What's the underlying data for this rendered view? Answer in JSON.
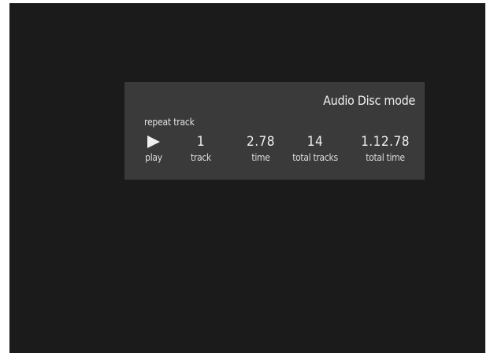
{
  "player": {
    "mode_title": "Audio Disc mode",
    "repeat_status": "repeat track",
    "state": {
      "icon": "play-icon",
      "label": "play"
    },
    "track": {
      "value": "1",
      "label": "track"
    },
    "time": {
      "value": "2.78",
      "label": "time"
    },
    "total_tracks": {
      "value": "14",
      "label": "total tracks"
    },
    "total_time": {
      "value": "1.12.78",
      "label": "total time"
    }
  },
  "colors": {
    "screen_background": "#1b1b1b",
    "panel_background": "#3a3a3a",
    "text": "#f0f0f0"
  }
}
